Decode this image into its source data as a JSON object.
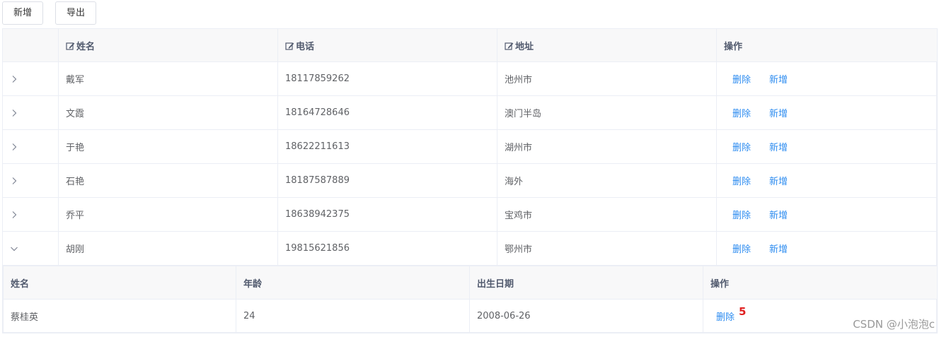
{
  "toolbar": {
    "add_label": "新增",
    "export_label": "导出"
  },
  "main_table": {
    "headers": {
      "name": "姓名",
      "phone": "电话",
      "address": "地址",
      "actions": "操作"
    },
    "rows": [
      {
        "name": "戴军",
        "phone": "18117859262",
        "address": "池州市",
        "expanded": false
      },
      {
        "name": "文霞",
        "phone": "18164728646",
        "address": "澳门半岛",
        "expanded": false
      },
      {
        "name": "于艳",
        "phone": "18622211613",
        "address": "湖州市",
        "expanded": false
      },
      {
        "name": "石艳",
        "phone": "18187587889",
        "address": "海外",
        "expanded": false
      },
      {
        "name": "乔平",
        "phone": "18638942375",
        "address": "宝鸡市",
        "expanded": false
      },
      {
        "name": "胡刚",
        "phone": "19815621856",
        "address": "鄂州市",
        "expanded": true
      }
    ],
    "action_labels": {
      "delete": "删除",
      "add": "新增"
    }
  },
  "detail_table": {
    "headers": {
      "name": "姓名",
      "age": "年龄",
      "birth": "出生日期",
      "actions": "操作"
    },
    "rows": [
      {
        "name": "蔡桂英",
        "age": "24",
        "birth": "2008-06-26",
        "delete": "删除",
        "badge": "5"
      }
    ]
  },
  "watermark": "CSDN @小泡泡c",
  "colors": {
    "link": "#2d8cf0",
    "header_bg": "#f8f8f9",
    "border": "#ebeef5",
    "badge": "#e02020"
  }
}
